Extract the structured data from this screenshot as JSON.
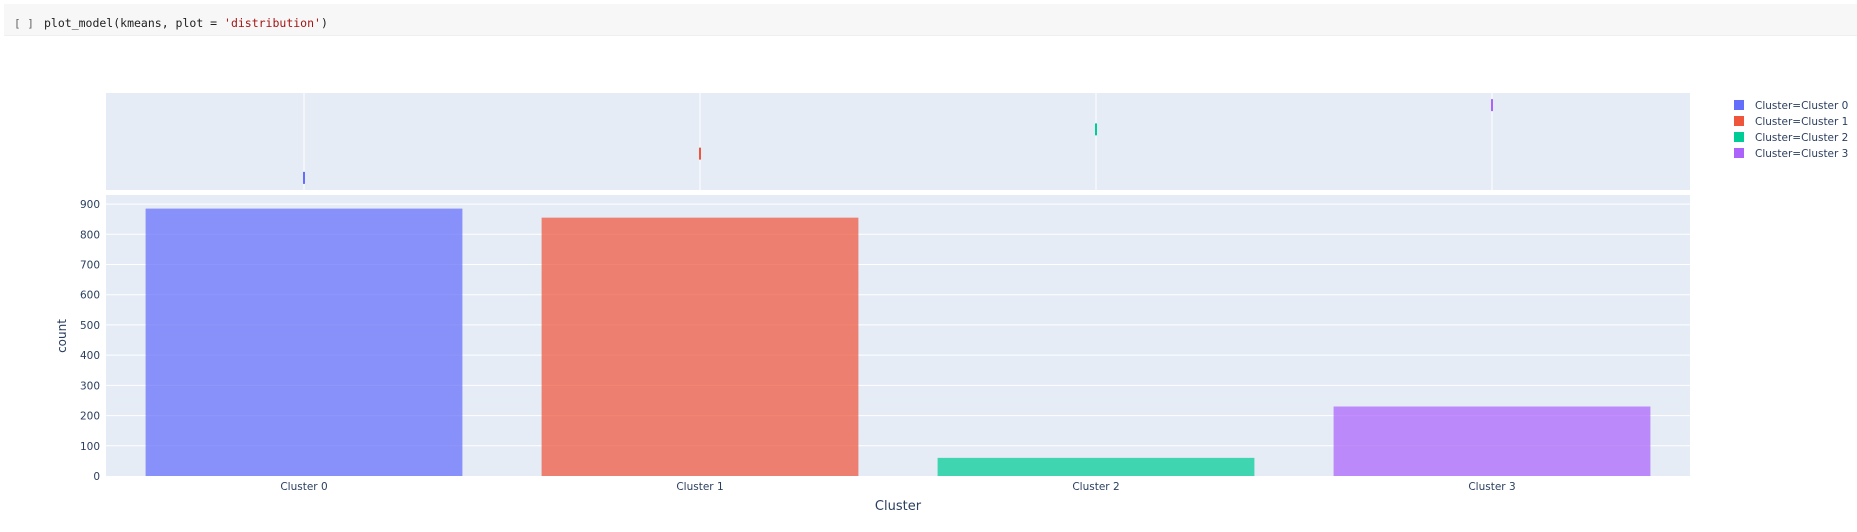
{
  "cell": {
    "run_indicator": "[ ]",
    "code_prefix": "plot_model(kmeans, plot = ",
    "code_string": "'distribution'",
    "code_suffix": ")"
  },
  "colors": {
    "plot_bg": "#e5ecf6",
    "grid": "#ffffff",
    "axis_text": "#2a3f5f",
    "series": [
      "#636efa",
      "#ef553b",
      "#00cc96",
      "#ab63fa"
    ]
  },
  "chart_data": {
    "type": "bar",
    "title": "",
    "xlabel": "Cluster",
    "ylabel": "count",
    "categories": [
      "Cluster 0",
      "Cluster 1",
      "Cluster 2",
      "Cluster 3"
    ],
    "values": [
      885,
      855,
      60,
      230
    ],
    "ylim": [
      0,
      930
    ],
    "yticks": [
      0,
      100,
      200,
      300,
      400,
      500,
      600,
      700,
      800,
      900
    ],
    "legend": [
      "Cluster=Cluster 0",
      "Cluster=Cluster 1",
      "Cluster=Cluster 2",
      "Cluster=Cluster 3"
    ],
    "legend_position": "top-right",
    "marginal": "rug",
    "grid": true
  }
}
